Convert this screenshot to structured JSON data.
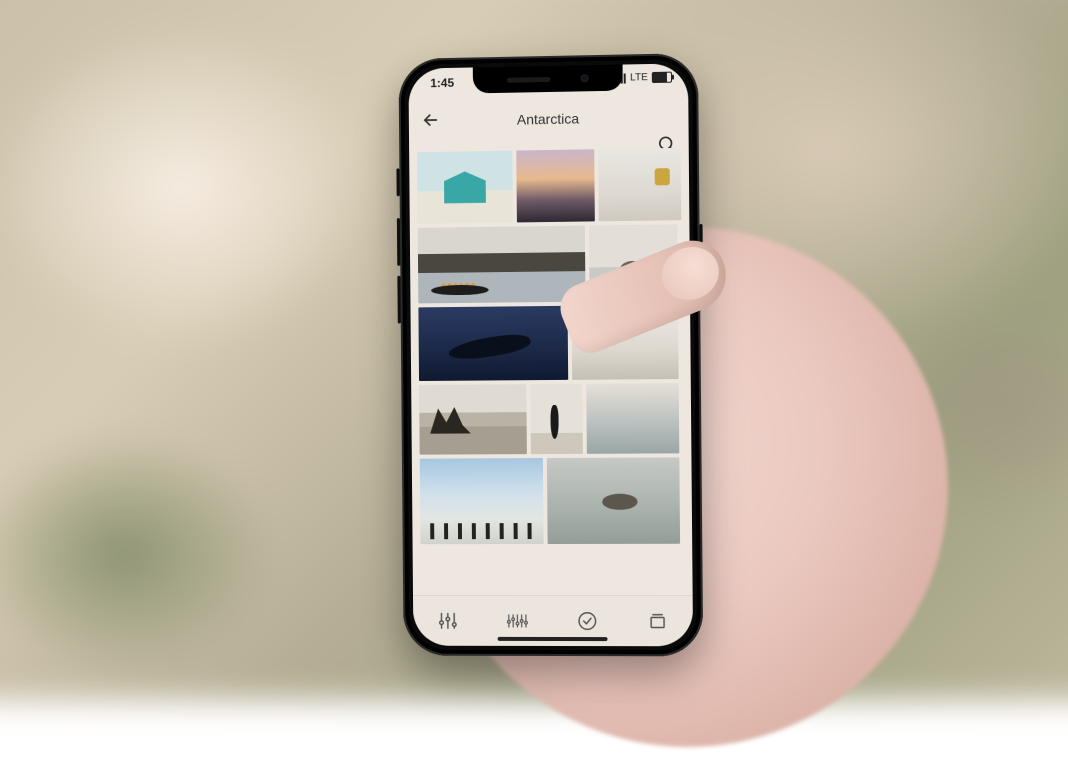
{
  "status": {
    "time": "1:45",
    "network": "LTE"
  },
  "header": {
    "title": "Antarctica"
  },
  "icons": {
    "back": "back-arrow-icon",
    "search": "search-icon",
    "sliders": "sliders-icon",
    "sliders_multi": "multi-sliders-icon",
    "check": "check-circle-icon",
    "stack": "stack-icon"
  }
}
